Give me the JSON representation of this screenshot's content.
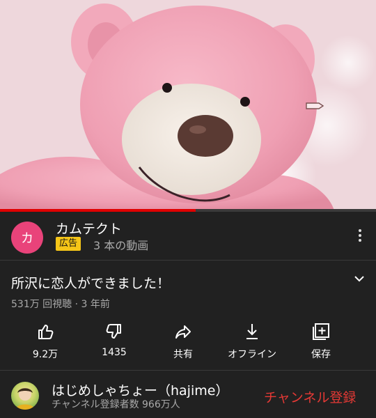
{
  "video": {
    "thumbnail_alt": "pink teddy bear",
    "progress_percent": 52,
    "progress_color": "#e00000",
    "title": "所沢に恋人ができました！",
    "views": "531万 回視聴",
    "age": "3 年前"
  },
  "ad": {
    "avatar_letter": "カ",
    "avatar_color": "#e9437a",
    "name": "カムテクト",
    "badge": "広告",
    "video_count": "3 本の動画"
  },
  "actions": [
    {
      "label": "9.2万",
      "icon": "thumbs-up-icon"
    },
    {
      "label": "1435",
      "icon": "thumbs-down-icon"
    },
    {
      "label": "共有",
      "icon": "share-icon"
    },
    {
      "label": "オフライン",
      "icon": "download-icon"
    },
    {
      "label": "保存",
      "icon": "playlist-add-icon"
    }
  ],
  "channel": {
    "name": "はじめしゃちょー（hajime）",
    "subscribers": "チャンネル登録者数 966万人",
    "subscribe_label": "チャンネル登録",
    "subscribe_color": "#e53935"
  }
}
